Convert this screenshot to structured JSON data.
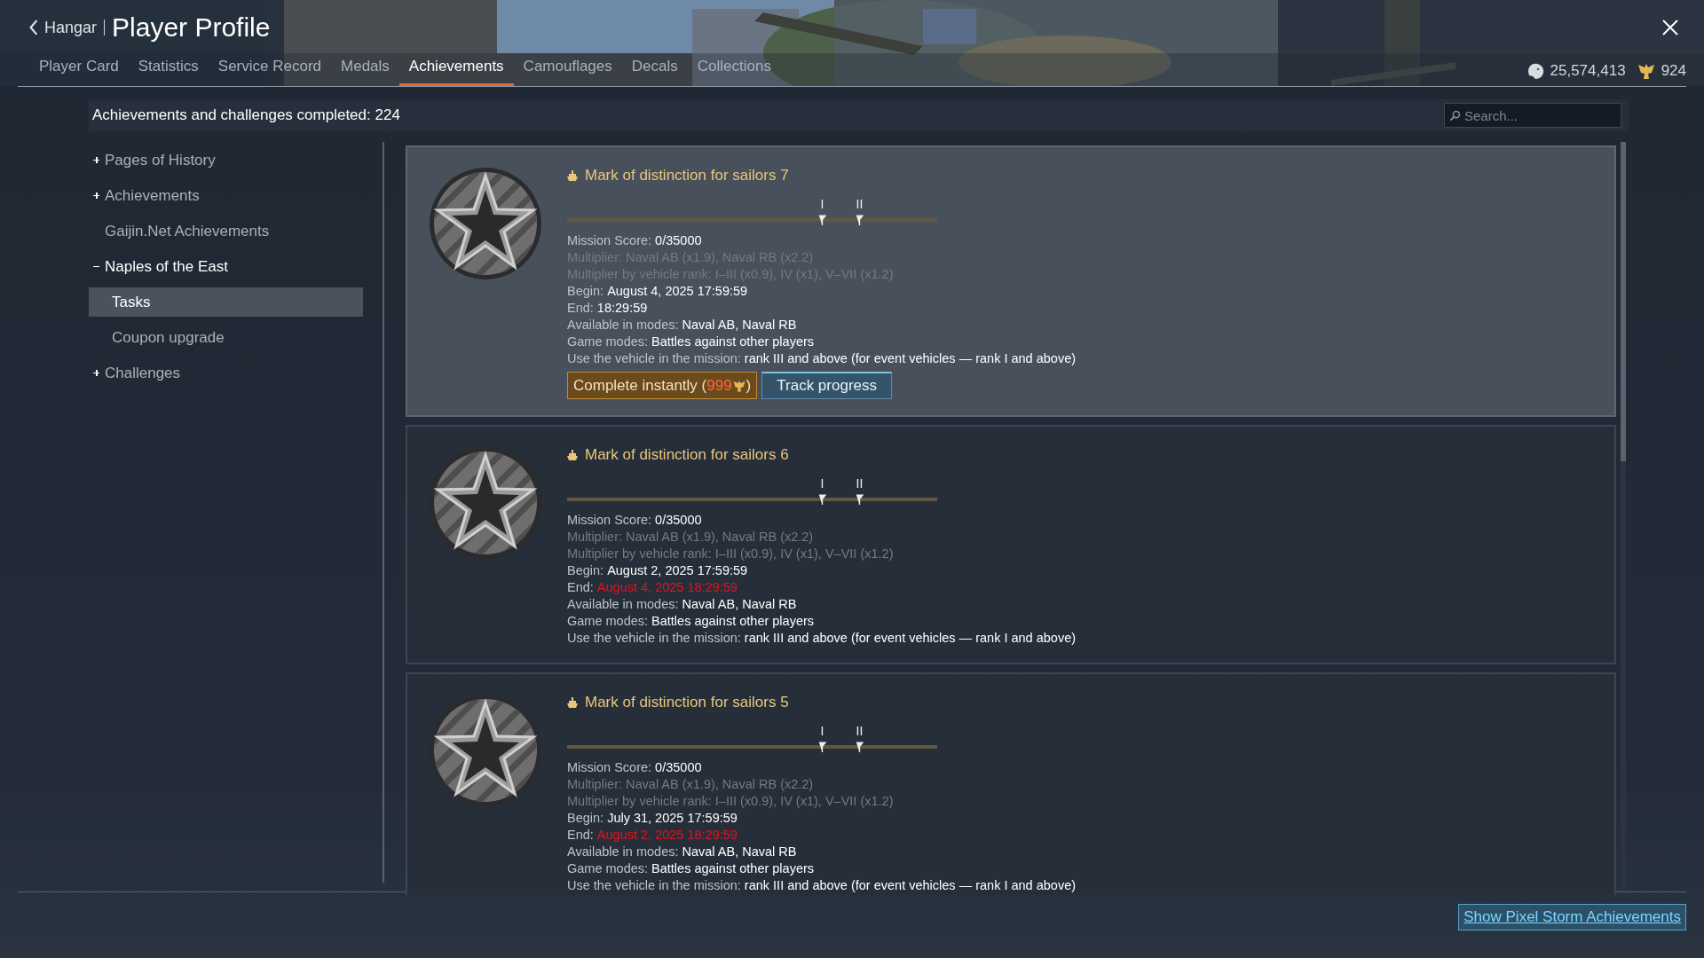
{
  "header": {
    "back_label": "Hangar",
    "title": "Player Profile",
    "tabs": [
      {
        "label": "Player Card",
        "selected": false
      },
      {
        "label": "Statistics",
        "selected": false
      },
      {
        "label": "Service Record",
        "selected": false
      },
      {
        "label": "Medals",
        "selected": false
      },
      {
        "label": "Achievements",
        "selected": true
      },
      {
        "label": "Camouflages",
        "selected": false
      },
      {
        "label": "Decals",
        "selected": false
      },
      {
        "label": "Collections",
        "selected": false
      }
    ],
    "silver_lions": "25,574,413",
    "golden_eagles": "924"
  },
  "summary": "Achievements and challenges completed: 224",
  "search": {
    "placeholder": "Search..."
  },
  "sidebar": {
    "items": [
      {
        "label": "Pages of History",
        "expanded": false
      },
      {
        "label": "Achievements",
        "expanded": false
      },
      {
        "label": "Gaijin.Net Achievements"
      },
      {
        "label": "Naples of the East",
        "expanded": true,
        "children": [
          {
            "label": "Tasks",
            "selected": true
          },
          {
            "label": "Coupon upgrade",
            "selected": false
          }
        ]
      },
      {
        "label": "Challenges",
        "expanded": false
      }
    ]
  },
  "tasks": [
    {
      "title": "Mark of distinction for sailors 7",
      "selected": true,
      "level": 0,
      "milestones": [
        "I",
        "II"
      ],
      "lines": [
        {
          "label": "Mission Score:",
          "value": "0/35000",
          "kind": "normal"
        },
        {
          "label": "Multiplier: Naval AB (x1.9), Naval RB (x2.2)",
          "kind": "dim"
        },
        {
          "label": "Multiplier by vehicle rank: I–III (x0.9), IV (x1), V–VII (x1.2)",
          "kind": "dim"
        },
        {
          "label": "Begin:",
          "value": "August 4, 2025 17:59:59",
          "kind": "normal"
        },
        {
          "label": "End:",
          "value": "18:29:59",
          "kind": "normal"
        },
        {
          "label": "Available in modes:",
          "value": "Naval AB, Naval RB",
          "kind": "normal"
        },
        {
          "label": "Game modes:",
          "value": "Battles against other players",
          "kind": "normal"
        },
        {
          "label": "Use the vehicle in the mission:",
          "value": "rank III and above (for event vehicles — rank I and above)",
          "kind": "normal"
        }
      ],
      "complete_button": {
        "label": "Complete instantly (",
        "price": "999",
        "close": ")"
      },
      "track_button": "Track progress"
    },
    {
      "title": "Mark of distinction for sailors 6",
      "selected": false,
      "level": 0,
      "milestones": [
        "I",
        "II"
      ],
      "lines": [
        {
          "label": "Mission Score:",
          "value": "0/35000",
          "kind": "normal"
        },
        {
          "label": "Multiplier: Naval AB (x1.9), Naval RB (x2.2)",
          "kind": "dim"
        },
        {
          "label": "Multiplier by vehicle rank: I–III (x0.9), IV (x1), V–VII (x1.2)",
          "kind": "dim"
        },
        {
          "label": "Begin:",
          "value": "August 2, 2025 17:59:59",
          "kind": "normal"
        },
        {
          "label": "End:",
          "value": "August 4, 2025 18:29:59",
          "kind": "alert"
        },
        {
          "label": "Available in modes:",
          "value": "Naval AB, Naval RB",
          "kind": "normal"
        },
        {
          "label": "Game modes:",
          "value": "Battles against other players",
          "kind": "normal"
        },
        {
          "label": "Use the vehicle in the mission:",
          "value": "rank III and above (for event vehicles — rank I and above)",
          "kind": "normal"
        }
      ]
    },
    {
      "title": "Mark of distinction for sailors 5",
      "selected": false,
      "level": 0,
      "milestones": [
        "I",
        "II"
      ],
      "lines": [
        {
          "label": "Mission Score:",
          "value": "0/35000",
          "kind": "normal"
        },
        {
          "label": "Multiplier: Naval AB (x1.9), Naval RB (x2.2)",
          "kind": "dim"
        },
        {
          "label": "Multiplier by vehicle rank: I–III (x0.9), IV (x1), V–VII (x1.2)",
          "kind": "dim"
        },
        {
          "label": "Begin:",
          "value": "July 31, 2025 17:59:59",
          "kind": "normal"
        },
        {
          "label": "End:",
          "value": "August 2, 2025 18:29:59",
          "kind": "alert"
        },
        {
          "label": "Available in modes:",
          "value": "Naval AB, Naval RB",
          "kind": "normal"
        },
        {
          "label": "Game modes:",
          "value": "Battles against other players",
          "kind": "normal"
        },
        {
          "label": "Use the vehicle in the mission:",
          "value": "rank III and above (for event vehicles — rank I and above)",
          "kind": "normal"
        }
      ]
    }
  ],
  "footer_button": "Show Pixel Storm Achievements"
}
